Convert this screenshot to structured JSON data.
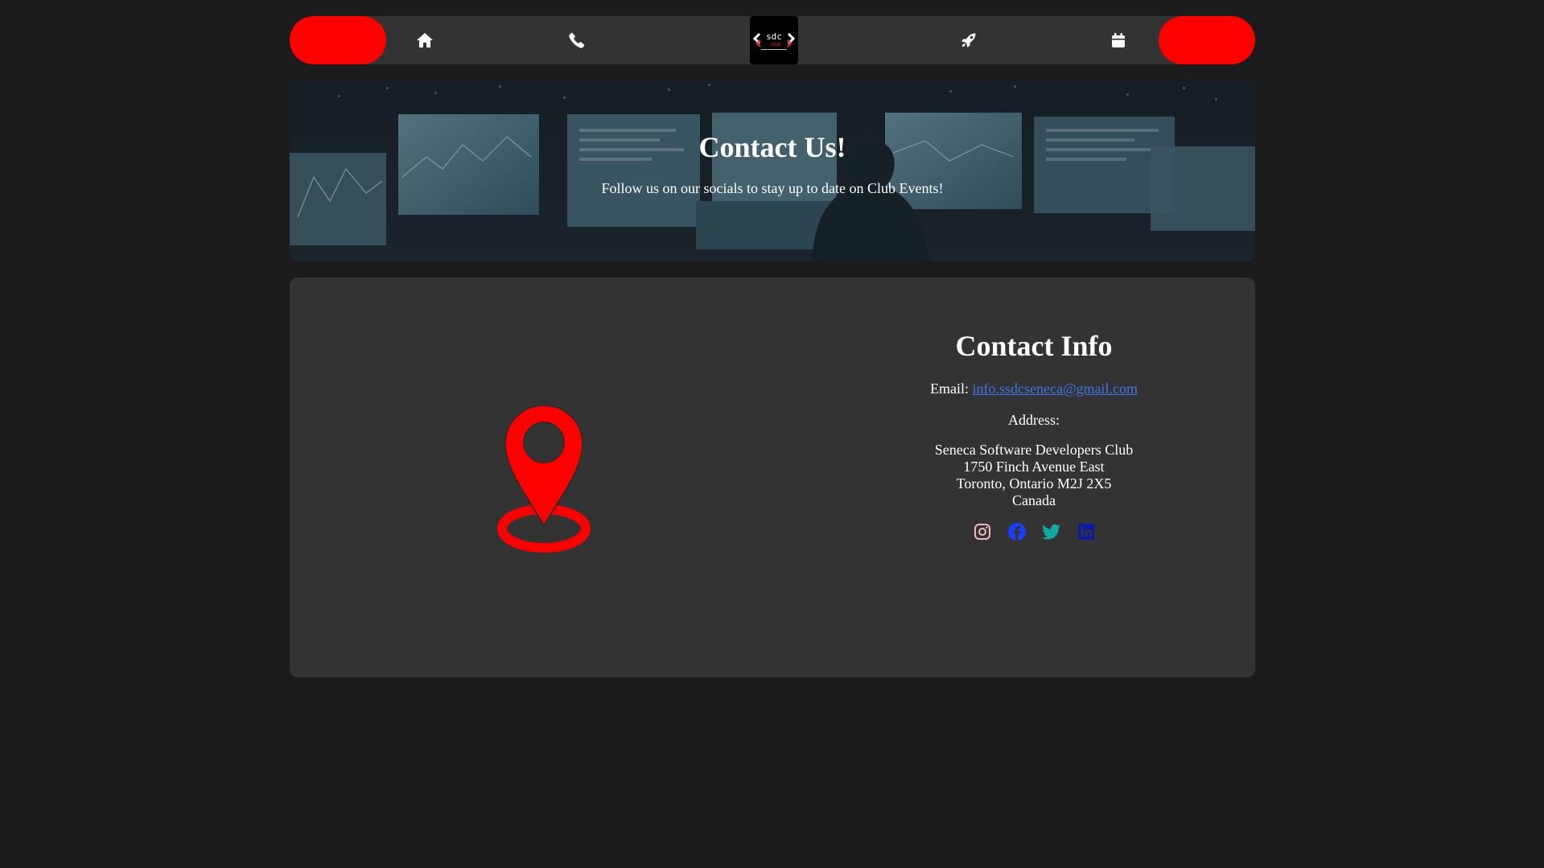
{
  "nav": {
    "icons": [
      "home-icon",
      "phone-icon",
      "rocket-icon",
      "calendar-icon"
    ],
    "logo_text": "sdc",
    "pill_color": "#ff0000"
  },
  "hero": {
    "title": "Contact Us!",
    "subtitle": "Follow us on our socials to stay up to date on Club Events!"
  },
  "contact": {
    "title": "Contact Info",
    "email_label": "Email:",
    "email": "info.ssdcseneca@gmail.com",
    "address_label": "Address:",
    "address_lines": [
      "Seneca Software Developers Club",
      "1750 Finch Avenue East",
      "Toronto, Ontario M2J 2X5",
      "Canada"
    ],
    "socials": [
      {
        "name": "instagram-icon",
        "color": "#f8b6c4"
      },
      {
        "name": "facebook-icon",
        "color": "#1a3cff"
      },
      {
        "name": "twitter-icon",
        "color": "#13a8a0"
      },
      {
        "name": "linkedin-icon",
        "color": "#0a1aa8"
      }
    ]
  },
  "colors": {
    "background": "#1b1b1c",
    "card": "#333333",
    "accent": "#ff0000",
    "link": "#3a76e8"
  }
}
